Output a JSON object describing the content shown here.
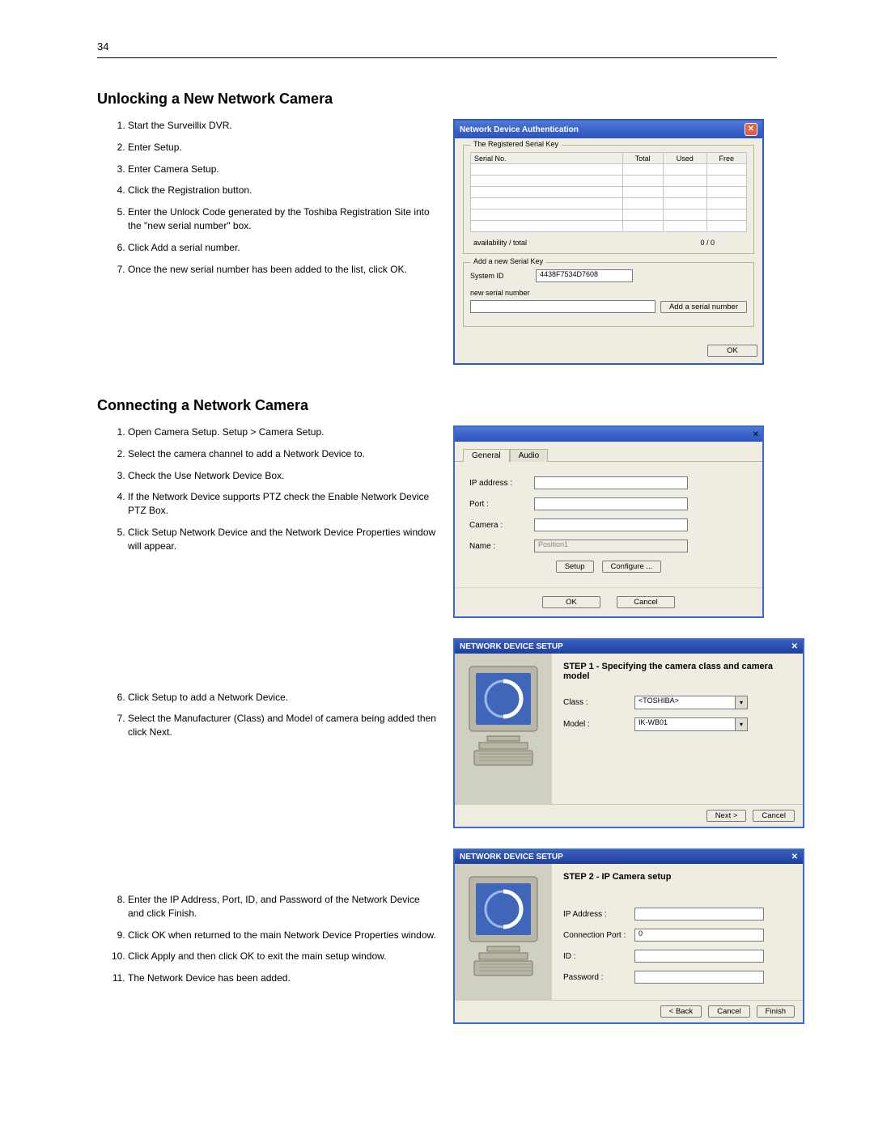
{
  "page_number": "34",
  "section1": {
    "heading": "Unlocking a New Network Camera",
    "steps": [
      "Start the Surveillix DVR.",
      "Enter Setup.",
      "Enter Camera Setup.",
      "Click the Registration button.",
      "Enter the Unlock Code generated by the Toshiba Registration Site into the \"new serial number\" box.",
      "Click Add a serial number.",
      "Once the new serial number has been added to the list, click OK."
    ]
  },
  "dlg1": {
    "title": "Network Device Authentication",
    "group1_legend": "The Registered Serial Key",
    "cols": {
      "c1": "Serial No.",
      "c2": "Total",
      "c3": "Used",
      "c4": "Free"
    },
    "avail_label": "availability / total",
    "avail_value": "0 / 0",
    "group2_legend": "Add a new Serial Key",
    "system_id_label": "System ID",
    "system_id_value": "4438F7534D7608",
    "new_serial_label": "new serial number",
    "add_btn": "Add a serial number",
    "ok_btn": "OK"
  },
  "section2": {
    "heading": "Connecting a Network Camera",
    "steps_a": [
      "Open Camera Setup.   Setup > Camera Setup.",
      "Select the camera channel to add a Network Device to.",
      "Check the Use Network Device Box.",
      "If the Network Device supports PTZ check the Enable Network Device PTZ Box.",
      "Click Setup Network Device and the Network Device Properties window will appear."
    ],
    "steps_b": [
      "Click Setup to add a Network Device.",
      "Select the Manufacturer (Class) and Model of camera being added then click Next."
    ],
    "steps_c": [
      "Enter the IP Address, Port, ID, and Password of the Network Device and click Finish.",
      "Click OK when returned to the main Network Device Properties window.",
      "Click Apply and then click OK to exit the main setup window.",
      "The Network Device has been added."
    ]
  },
  "dlg2": {
    "tab1": "General",
    "tab2": "Audio",
    "ip_label": "IP address :",
    "port_label": "Port :",
    "camera_label": "Camera :",
    "name_label": "Name :",
    "name_value": "Position1",
    "setup_btn": "Setup",
    "configure_btn": "Configure ...",
    "ok_btn": "OK",
    "cancel_btn": "Cancel"
  },
  "wiz1": {
    "title": "NETWORK DEVICE SETUP",
    "step": "STEP 1 -   Specifying the camera class and camera model",
    "class_label": "Class :",
    "class_value": "<TOSHIBA>",
    "model_label": "Model :",
    "model_value": "IK-WB01",
    "next_btn": "Next >",
    "cancel_btn": "Cancel"
  },
  "wiz2": {
    "title": "NETWORK DEVICE SETUP",
    "step": "STEP 2 -   IP Camera setup",
    "ip_label": "IP Address :",
    "port_label": "Connection Port :",
    "port_value": "0",
    "id_label": "ID :",
    "pw_label": "Password :",
    "back_btn": "< Back",
    "cancel_btn": "Cancel",
    "finish_btn": "Finish"
  }
}
